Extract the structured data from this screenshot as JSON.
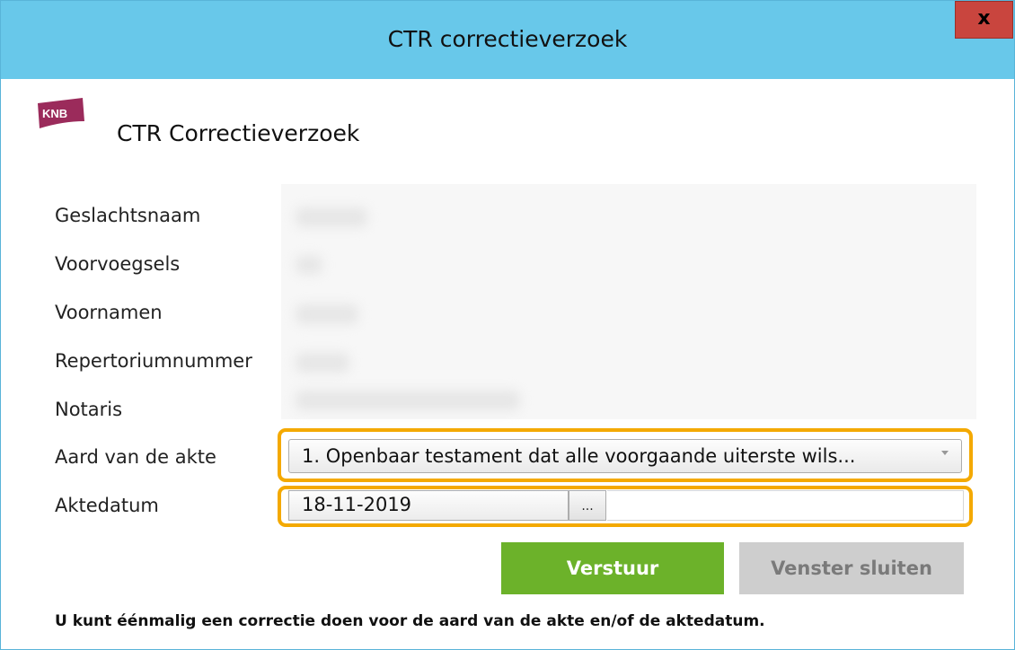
{
  "window": {
    "title": "CTR correctieverzoek",
    "close_label": "x"
  },
  "header": {
    "logo_text": "KNB",
    "title": "CTR Correctieverzoek"
  },
  "fields": {
    "geslachtsnaam": "Geslachtsnaam",
    "voorvoegsels": "Voorvoegsels",
    "voornamen": "Voornamen",
    "repertoriumnummer": "Repertoriumnummer",
    "notaris": "Notaris",
    "aard_label": "Aard van de akte",
    "aard_value": "1. Openbaar testament dat alle voorgaande uiterste wils...",
    "aktedatum_label": "Aktedatum",
    "aktedatum_value": "18-11-2019",
    "date_button": "..."
  },
  "buttons": {
    "send": "Verstuur",
    "close": "Venster sluiten"
  },
  "footer": {
    "note": "U kunt éénmalig een correctie doen voor de aard van de akte en/of de aktedatum."
  },
  "colors": {
    "titlebar": "#68c8ea",
    "close": "#c9453e",
    "highlight": "#f4a900",
    "send": "#6cb22a",
    "brand": "#9b2b5b"
  }
}
